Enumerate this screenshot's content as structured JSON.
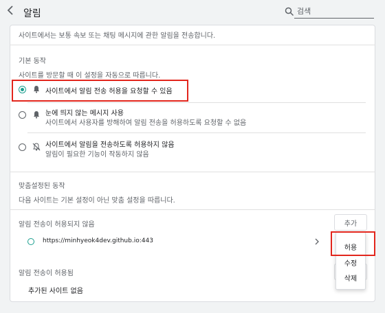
{
  "header": {
    "back_label": "‹",
    "title": "알림",
    "search_placeholder": "검색"
  },
  "intro": "사이트에서는 보통 속보 또는 채팅 메시지에 관한 알림을 전송합니다.",
  "default_behavior": {
    "heading": "기본 동작",
    "description": "사이트를 방문할 때 이 설정을 자동으로 따릅니다.",
    "options": [
      {
        "title": "사이트에서 알림 전송 허용을 요청할 수 있음",
        "subtitle": "",
        "checked": true,
        "icon": "bell-icon"
      },
      {
        "title": "눈에 띄지 않는 메시지 사용",
        "subtitle": "사이트에서 사용자를 방해하여 알림 전송을 허용하도록 요청할 수 없음",
        "checked": false,
        "icon": "bell-icon"
      },
      {
        "title": "사이트에서 알림을 전송하도록 허용하지 않음",
        "subtitle": "알림이 필요한 기능이 작동하지 않음",
        "checked": false,
        "icon": "bell-off-icon"
      }
    ]
  },
  "custom_behavior": {
    "heading": "맞춤설정된 동작",
    "description": "다음 사이트는 기본 설정이 아닌 맞춤 설정을 따릅니다."
  },
  "blocked": {
    "heading": "알림 전송이 허용되지 않음",
    "add_label": "추가",
    "sites": [
      {
        "url": "https://minhyeok4dev.github.io:443"
      }
    ]
  },
  "allowed": {
    "heading": "알림 전송이 허용됨",
    "empty_label": "추가된 사이트 없음"
  },
  "context_menu": {
    "items": [
      "허용",
      "수정",
      "삭제"
    ]
  },
  "colors": {
    "accent": "#1a9e8e",
    "highlight": "#e2251c"
  }
}
